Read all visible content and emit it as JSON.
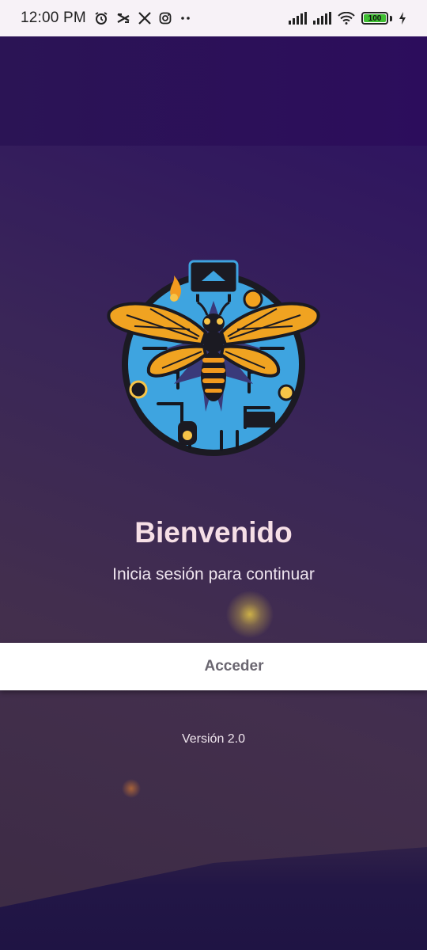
{
  "status_bar": {
    "time": "12:00 PM",
    "left_icons": [
      "alarm-icon",
      "capcut-icon",
      "x-icon",
      "instagram-icon",
      "more-dots-icon"
    ],
    "right_icons": [
      "signal-icon",
      "signal-icon",
      "wifi-icon",
      "battery-icon",
      "charging-icon"
    ],
    "battery_level": "100",
    "battery_fraction": 1.0
  },
  "logo": {
    "icon": "bee-circuit-logo-icon"
  },
  "welcome": {
    "title": "Bienvenido",
    "subtitle": "Inicia sesión para continuar"
  },
  "actions": {
    "access_label": "Acceder"
  },
  "footer": {
    "version": "Versión 2.0"
  },
  "colors": {
    "top_band": "#2c0d5c",
    "background": "#3a2658",
    "title_text": "#f6dfe6",
    "button_bg": "#ffffff",
    "button_text": "#6a6670",
    "battery_fill": "#3fbf32"
  }
}
